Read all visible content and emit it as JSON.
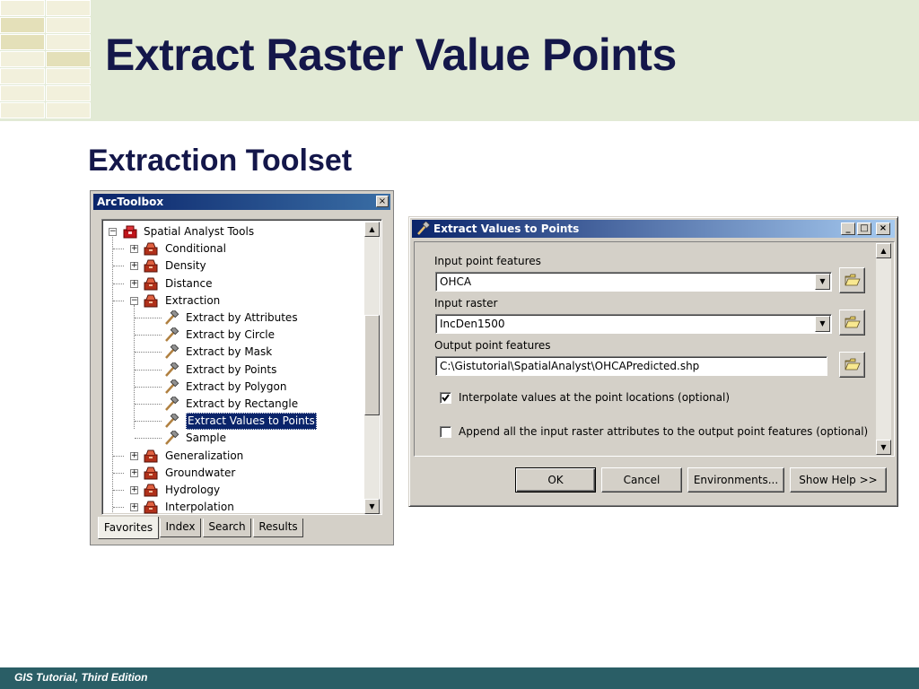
{
  "slide": {
    "title": "Extract Raster Value Points",
    "subtitle": "Extraction Toolset",
    "footer": "GIS Tutorial, Third Edition"
  },
  "toolbox": {
    "title": "ArcToolbox",
    "close": "×",
    "root": "Spatial Analyst Tools",
    "items": [
      {
        "label": "Conditional",
        "kind": "toolset",
        "expander": "+"
      },
      {
        "label": "Density",
        "kind": "toolset",
        "expander": "+"
      },
      {
        "label": "Distance",
        "kind": "toolset",
        "expander": "+"
      },
      {
        "label": "Extraction",
        "kind": "toolset",
        "expander": "−"
      },
      {
        "label": "Extract by Attributes",
        "kind": "tool"
      },
      {
        "label": "Extract by Circle",
        "kind": "tool"
      },
      {
        "label": "Extract by Mask",
        "kind": "tool"
      },
      {
        "label": "Extract by Points",
        "kind": "tool"
      },
      {
        "label": "Extract by Polygon",
        "kind": "tool"
      },
      {
        "label": "Extract by Rectangle",
        "kind": "tool"
      },
      {
        "label": "Extract Values to Points",
        "kind": "tool",
        "selected": true
      },
      {
        "label": "Sample",
        "kind": "tool"
      },
      {
        "label": "Generalization",
        "kind": "toolset",
        "expander": "+"
      },
      {
        "label": "Groundwater",
        "kind": "toolset",
        "expander": "+"
      },
      {
        "label": "Hydrology",
        "kind": "toolset",
        "expander": "+"
      },
      {
        "label": "Interpolation",
        "kind": "toolset",
        "expander": "+"
      }
    ],
    "tabs": [
      "Favorites",
      "Index",
      "Search",
      "Results"
    ],
    "active_tab": "Favorites"
  },
  "dialog": {
    "title": "Extract Values to Points",
    "controls": {
      "minimize": "_",
      "maximize": "□",
      "close": "×"
    },
    "input_point_label": "Input point features",
    "input_point_value": "OHCA",
    "input_raster_label": "Input raster",
    "input_raster_value": "IncDen1500",
    "output_label": "Output point features",
    "output_value": "C:\\Gistutorial\\SpatialAnalyst\\OHCAPredicted.shp",
    "interpolate_label": "Interpolate values at the point locations (optional)",
    "interpolate_checked": true,
    "append_label": "Append all the input raster attributes to the output point features (optional)",
    "append_checked": false,
    "buttons": {
      "ok": "OK",
      "cancel": "Cancel",
      "environments": "Environments...",
      "help": "Show Help >>"
    }
  },
  "colors": {
    "title_text": "#14174a",
    "header_bg": "#e2ead5",
    "footer_bg": "#2a5e66",
    "titlebar": "#0a246a",
    "window_face": "#d4d0c8"
  }
}
